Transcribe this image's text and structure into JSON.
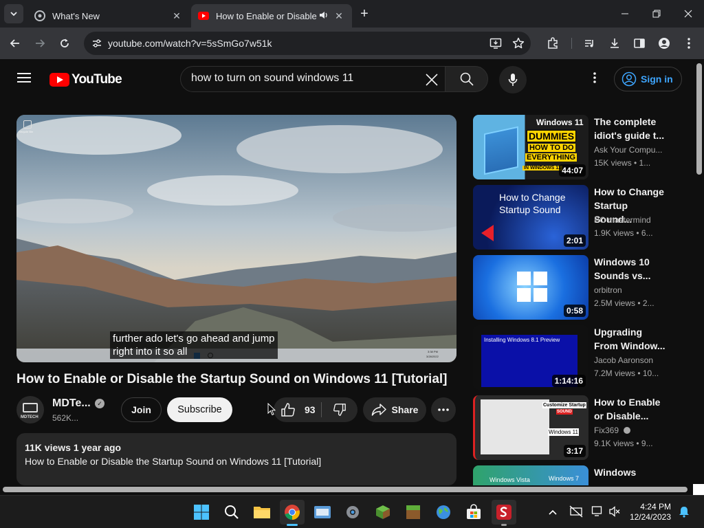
{
  "browser": {
    "tabs": [
      {
        "title": "What's New",
        "active": false
      },
      {
        "title": "How to Enable or Disable the Startup Sound on Windows 11 [Tutorial]",
        "active": true
      }
    ],
    "url": "youtube.com/watch?v=5sSmGo7w51k"
  },
  "youtube": {
    "logo_text": "YouTube",
    "search": {
      "value": "how to turn on sound windows 11"
    },
    "signin_label": "Sign in"
  },
  "player": {
    "caption_line1": "further ado let's go ahead and jump",
    "caption_line2": "right into it so all",
    "overlay_label": "Recycle Bin",
    "overlay_time": "3:38 PM",
    "overlay_date": "3/28/2022"
  },
  "video": {
    "title": "How to Enable or Disable the Startup Sound on Windows 11 [Tutorial]",
    "channel": {
      "name": "MDTe...",
      "subscribers": "562K...",
      "avatar_text": "MDTECH"
    },
    "join_label": "Join",
    "subscribe_label": "Subscribe",
    "likes": "93",
    "share_label": "Share",
    "description": {
      "stats": "11K views  1 year ago",
      "text": "How to Enable or Disable the Startup Sound on Windows 11 [Tutorial]"
    }
  },
  "recommendations": [
    {
      "title": "The complete idiot's guide t...",
      "channel": "Ask Your Compu...",
      "meta": "15K views  • 1...",
      "duration": "44:07",
      "thumb": {
        "line1": "Windows 11",
        "line2": "DUMMIES",
        "line3": "HOW TO DO",
        "line4": "EVERYTHING",
        "line5": "IN WINDOWS 11"
      }
    },
    {
      "title": "How to Change Startup Sound...",
      "channel": "PC mastermind",
      "meta": "1.9K views  • 6...",
      "duration": "2:01",
      "thumb": {
        "line1": "How to Change",
        "line2": "Startup Sound"
      }
    },
    {
      "title": "Windows 10 Sounds vs...",
      "channel": "orbitron",
      "meta": "2.5M views  • 2...",
      "duration": "0:58"
    },
    {
      "title": "Upgrading From Window...",
      "channel": "Jacob Aaronson",
      "meta": "7.2M views  • 10...",
      "duration": "1:14:16",
      "thumb": {
        "line1": "Installing Windows 8.1 Preview"
      }
    },
    {
      "title": "How to Enable or Disable...",
      "channel": "Fix369",
      "meta": "9.1K views  • 9...",
      "duration": "3:17",
      "thumb": {
        "line1": "Customize Startup",
        "line2": "SOUND",
        "line3": "Windows 11"
      }
    },
    {
      "title": "Windows",
      "channel": "",
      "meta": "",
      "duration": "",
      "thumb": {
        "line1": "Windows Vista",
        "line2": "Windows 7"
      }
    }
  ],
  "taskbar": {
    "time": "4:24 PM",
    "date": "12/24/2023"
  }
}
